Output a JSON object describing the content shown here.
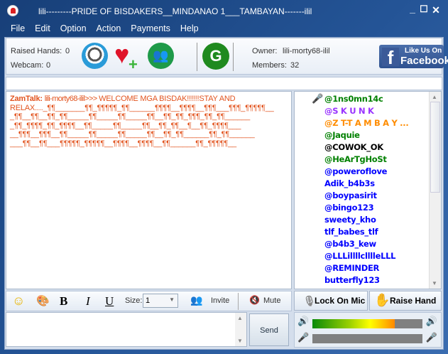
{
  "window": {
    "title": "lili---------PRIDE OF BISDAKERS__MINDANAO 1___TAMBAYAN-------ilil"
  },
  "menu": [
    "File",
    "Edit",
    "Option",
    "Action",
    "Payments",
    "Help"
  ],
  "toolbar": {
    "raised_hands_label": "Raised Hands:",
    "raised_hands": "0",
    "webcam_label": "Webcam:",
    "webcam": "0",
    "owner_label": "Owner:",
    "owner": "lili-morty68-ilil",
    "members_label": "Members:",
    "members": "32",
    "facebook_top": "Like Us On",
    "facebook_bottom": "Facebook",
    "g_label": "G"
  },
  "chat": {
    "sender": "ZamTalk:",
    "from": "lili-morty68-ilil>>> ",
    "lines": [
      "WELCOME MGA BISDAK!!!!!!STAY AND",
      "RELAX...._¶¶_______¶¶_¶¶¶¶¶_¶¶______¶¶¶¶__¶¶¶¶__¶¶¶___¶¶¶_¶¶¶¶¶__",
      "_¶¶__¶¶__¶¶_¶¶_____¶¶_____¶¶_____¶¶__¶¶_¶¶_¶¶¶_¶¶_¶¶______",
      "_¶¶_¶¶¶¶_¶¶_¶¶¶¶__¶¶_____¶¶_____¶¶__¶¶_¶¶__¶__¶¶_¶¶¶¶___",
      "__¶¶¶__¶¶¶__¶¶_____¶¶_____¶¶_____¶¶__¶¶_¶¶______¶¶_¶¶______",
      "___¶¶__¶¶___¶¶¶¶¶_¶¶¶¶¶__¶¶¶¶__¶¶¶¶__¶¶______¶¶_¶¶¶¶¶__"
    ]
  },
  "users": [
    {
      "name": "@1ns0mn14c",
      "color": "#008000"
    },
    {
      "name": "@S K U N K",
      "color": "#9933ff"
    },
    {
      "name": "@Z T-T A M B A Y ...",
      "color": "#ff8c00"
    },
    {
      "name": "@Jaquie",
      "color": "#008000"
    },
    {
      "name": "@COWOK_OK",
      "color": "#000000"
    },
    {
      "name": "@HeArTgHoSt",
      "color": "#008000"
    },
    {
      "name": "@poweroflove",
      "color": "#0000ff"
    },
    {
      "name": "Adik_b4b3s",
      "color": "#0000ff"
    },
    {
      "name": "@boypasirit",
      "color": "#0000ff"
    },
    {
      "name": "@bingo123",
      "color": "#0000ff"
    },
    {
      "name": "sweety_kho",
      "color": "#0000ff"
    },
    {
      "name": "tlf_babes_tlf",
      "color": "#0000ff"
    },
    {
      "name": "@b4b3_kew",
      "color": "#0000ff"
    },
    {
      "name": "@LLLillllclllleLLL",
      "color": "#0000ff"
    },
    {
      "name": "@REMINDER",
      "color": "#0000ff"
    },
    {
      "name": "butterfly123",
      "color": "#0000ff"
    }
  ],
  "format": {
    "bold": "B",
    "italic": "I",
    "underline": "U",
    "size_label": "Size:",
    "size": "1",
    "invite": "Invite",
    "mute": "Mute"
  },
  "send": "Send",
  "lock_mic": "Lock On Mic",
  "raise_hand": "Raise Hand",
  "speaker_level": 0.75,
  "mic_level": 0
}
